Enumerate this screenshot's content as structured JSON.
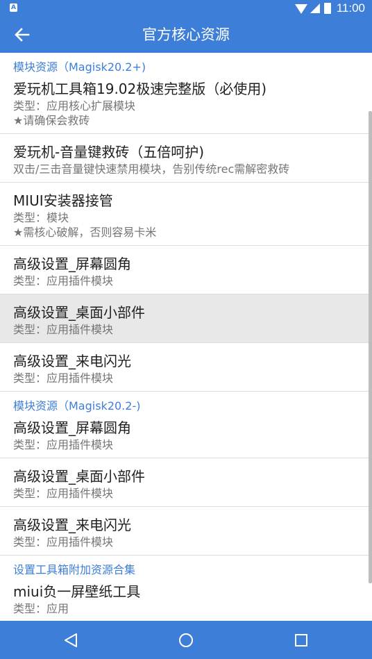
{
  "status": {
    "time": "11:00",
    "notification_icon": "A"
  },
  "appbar": {
    "title": "官方核心资源"
  },
  "sections": [
    {
      "header": "模块资源（Magisk20.2+)",
      "items": [
        {
          "title": "爱玩机工具箱19.02极速完整版（必使用)",
          "lines": [
            "类型：应用核心扩展模块",
            "★请确保会救砖"
          ]
        },
        {
          "title": "爱玩机-音量键救砖（五倍呵护)",
          "lines": [
            "双击/三击音量键快速禁用模块，告别传统rec需解密救砖"
          ]
        },
        {
          "title": "MIUI安装器接管",
          "lines": [
            "类型：模块",
            "★需核心破解，否则容易卡米"
          ]
        },
        {
          "title": "高级设置_屏幕圆角",
          "lines": [
            "类型：应用插件模块"
          ]
        },
        {
          "title": "高级设置_桌面小部件",
          "lines": [
            "类型：应用插件模块"
          ]
        },
        {
          "title": "高级设置_来电闪光",
          "lines": [
            "类型：应用插件模块"
          ]
        }
      ]
    },
    {
      "header": "模块资源（Magisk20.2-)",
      "items": [
        {
          "title": "高级设置_屏幕圆角",
          "lines": [
            "类型：应用插件模块"
          ]
        },
        {
          "title": "高级设置_桌面小部件",
          "lines": [
            "类型：应用插件模块"
          ]
        },
        {
          "title": "高级设置_来电闪光",
          "lines": [
            "类型：应用插件模块"
          ]
        }
      ]
    },
    {
      "header": "设置工具箱附加资源合集",
      "items": [
        {
          "title": "miui负一屏壁纸工具",
          "lines": [
            "类型：应用"
          ]
        }
      ]
    }
  ],
  "icons": {
    "back": "arrow-left-icon",
    "nav_back": "triangle-back-icon",
    "nav_home": "circle-home-icon",
    "nav_recents": "square-recents-icon"
  },
  "colors": {
    "primary": "#3d7ed8",
    "pressed_row": "#e8e8e8"
  }
}
